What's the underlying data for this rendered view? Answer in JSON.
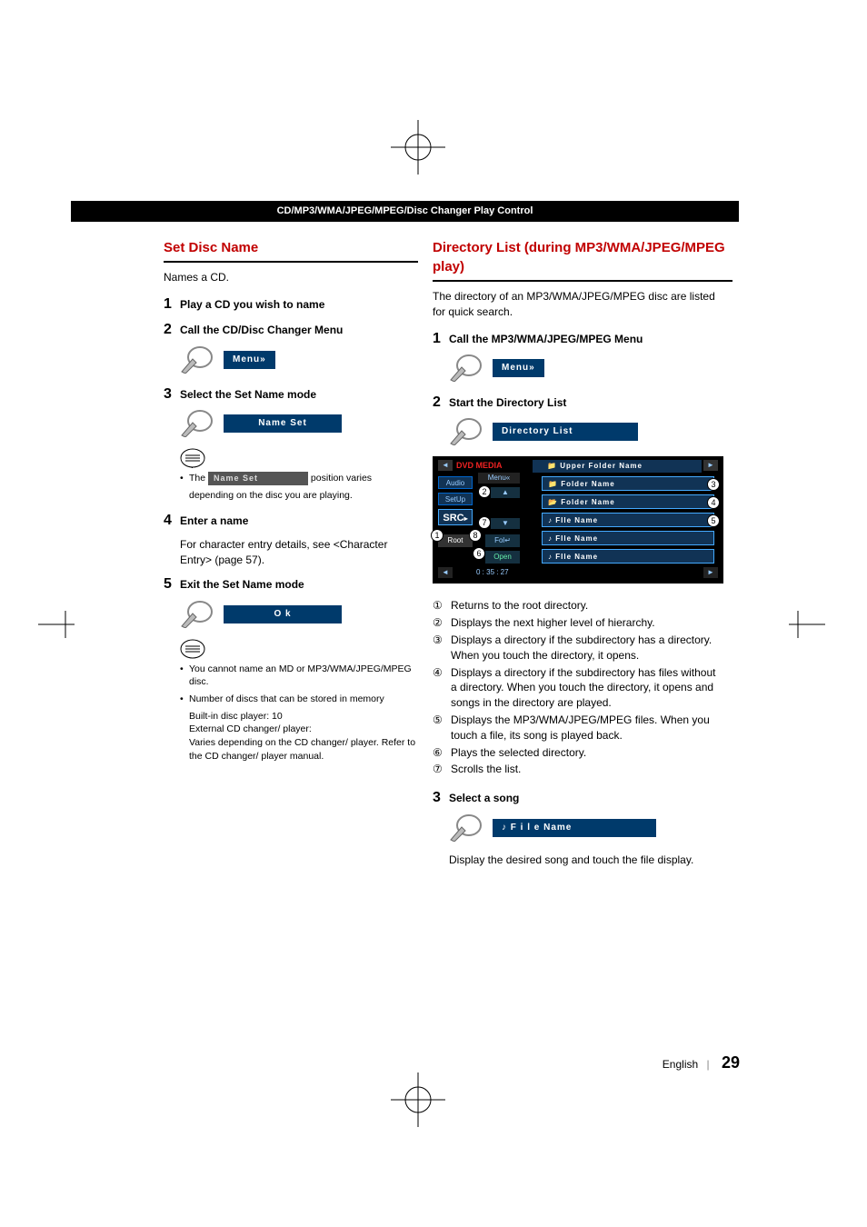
{
  "header_bar": "CD/MP3/WMA/JPEG/MPEG/Disc Changer Play Control",
  "left": {
    "section_title": "Set Disc Name",
    "intro": "Names a CD.",
    "step1_label": "Play a CD you wish to name",
    "step2_label": "Call the CD/Disc Changer Menu",
    "menu_btn": "Menu",
    "step3_label": "Select the Set Name mode",
    "nameset_btn": "Name Set",
    "note1_prefix": "The ",
    "note1_btn": "Name Set",
    "note1_suffix": " position varies",
    "note1_line2": "depending on the disc you are playing.",
    "step4_label": "Enter a name",
    "step4_body": "For character entry details, see <Character Entry> (page 57).",
    "step5_label": "Exit the Set Name mode",
    "ok_btn": "O k",
    "note2_b1": "You cannot name an MD or MP3/WMA/JPEG/MPEG disc.",
    "note2_b2": "Number of discs that can be stored in memory",
    "note2_l1": "Built-in disc player: 10",
    "note2_l2": "External CD changer/ player:",
    "note2_l3": "Varies depending on the CD changer/ player. Refer to the CD changer/ player manual."
  },
  "right": {
    "section_title": "Directory List (during MP3/WMA/JPEG/MPEG play)",
    "intro": "The directory of an MP3/WMA/JPEG/MPEG disc are listed for quick search.",
    "step1_label": "Call the MP3/WMA/JPEG/MPEG Menu",
    "menu_btn": "Menu",
    "step2_label": "Start the Directory List",
    "dirlist_btn": "Directory List",
    "screen": {
      "title": "DVD MEDIA",
      "menu": "Menu",
      "audio": "Audio",
      "setup": "SetUp",
      "src": "SRC",
      "root": "Root",
      "fol": "Fol",
      "open": "Open",
      "time": "0 : 35 : 27",
      "upper": "Upper Folder Name",
      "folder1": "Folder Name",
      "folder2": "Folder Name",
      "file1": "FIle Name",
      "file2": "FIle Name",
      "file3": "FIle Name"
    },
    "circ1": "Returns to the root directory.",
    "circ2": "Displays the next higher level of hierarchy.",
    "circ3": "Displays a directory if the subdirectory has a directory. When you touch the directory, it opens.",
    "circ4": "Displays a directory if the subdirectory has files without a directory. When you touch the directory, it opens and songs in the directory are played.",
    "circ5": "Displays the MP3/WMA/JPEG/MPEG files. When you touch a file, its song is played back.",
    "circ6": "Plays the selected directory.",
    "circ7": "Scrolls the list.",
    "step3_label": "Select a song",
    "file_btn": "♪ F i l e  Name",
    "step3_body": "Display the desired song and touch the file display."
  },
  "footer": {
    "lang": "English",
    "page": "29"
  },
  "nums": {
    "s1": "1",
    "s2": "2",
    "s3": "3",
    "s4": "4",
    "s5": "5"
  },
  "circles": {
    "c1": "①",
    "c2": "②",
    "c3": "③",
    "c4": "④",
    "c5": "⑤",
    "c6": "⑥",
    "c7": "⑦"
  }
}
